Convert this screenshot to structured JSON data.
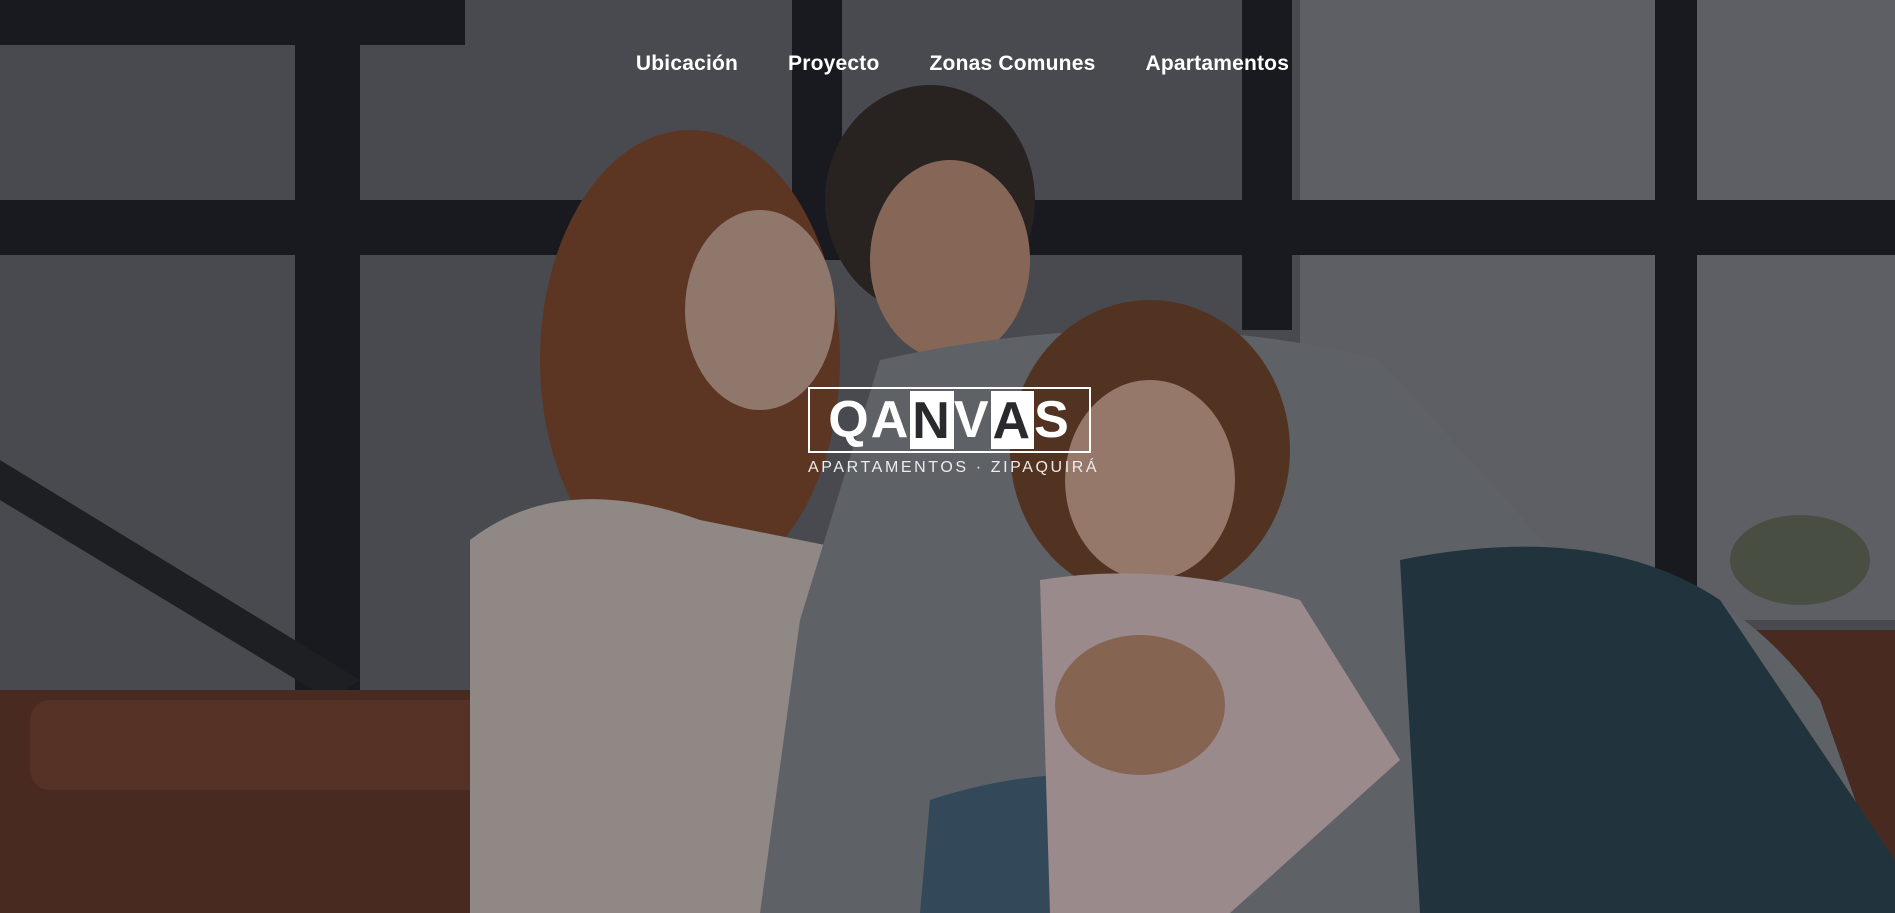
{
  "nav": {
    "items": [
      {
        "label": "Ubicación"
      },
      {
        "label": "Proyecto"
      },
      {
        "label": "Zonas Comunes"
      },
      {
        "label": "Apartamentos"
      }
    ]
  },
  "logo": {
    "letters": [
      "Q",
      "A",
      "N",
      "V",
      "A",
      "S"
    ],
    "tagline": "APARTAMENTOS · ZIPAQUIRÁ"
  },
  "hero": {
    "image": "family-on-sofa-photo"
  }
}
